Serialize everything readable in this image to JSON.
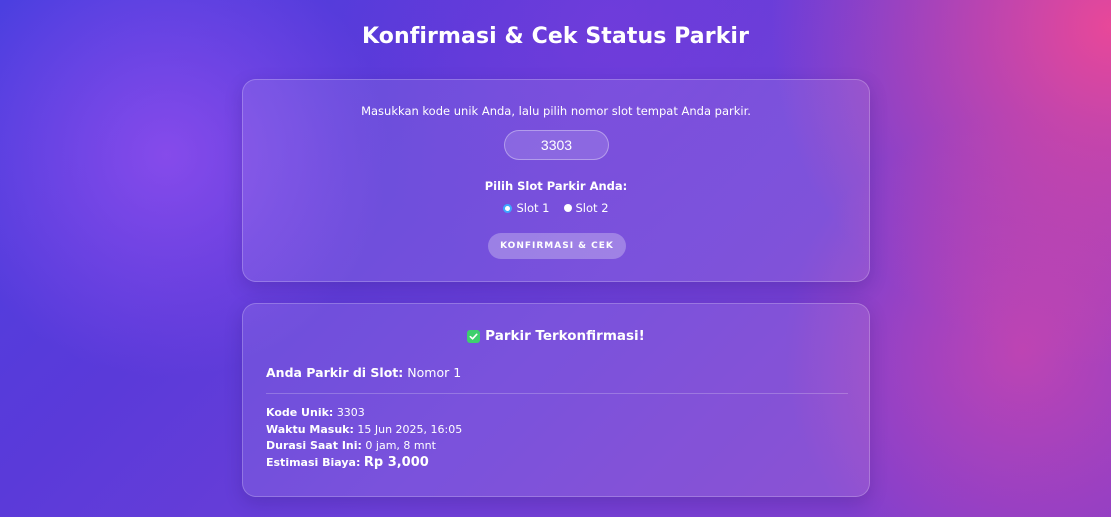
{
  "page": {
    "title": "Konfirmasi & Cek Status Parkir"
  },
  "form": {
    "instruction": "Masukkan kode unik Anda, lalu pilih nomor slot tempat Anda parkir.",
    "code_value": "3303",
    "slot_label": "Pilih Slot Parkir Anda:",
    "slots": [
      {
        "label": "Slot 1",
        "selected": true
      },
      {
        "label": "Slot 2",
        "selected": false
      }
    ],
    "confirm_button": "KONFIRMASI & CEK"
  },
  "result": {
    "icon": "check-mark-icon",
    "title": "Parkir Terkonfirmasi!",
    "slot_label": "Anda Parkir di Slot:",
    "slot_value": "Nomor 1",
    "code_label": "Kode Unik:",
    "code_value": "3303",
    "entry_label": "Waktu Masuk:",
    "entry_value": "15 Jun 2025, 16:05",
    "duration_label": "Durasi Saat Ini:",
    "duration_value": "0 jam, 8 mnt",
    "cost_label": "Estimasi Biaya:",
    "cost_value": "Rp 3,000"
  },
  "colors": {
    "accent_check": "#3ecf6e",
    "radio_selected_ring": "#3ea8ff",
    "background_start": "#4b3fe0",
    "background_pink": "#ee4896"
  }
}
